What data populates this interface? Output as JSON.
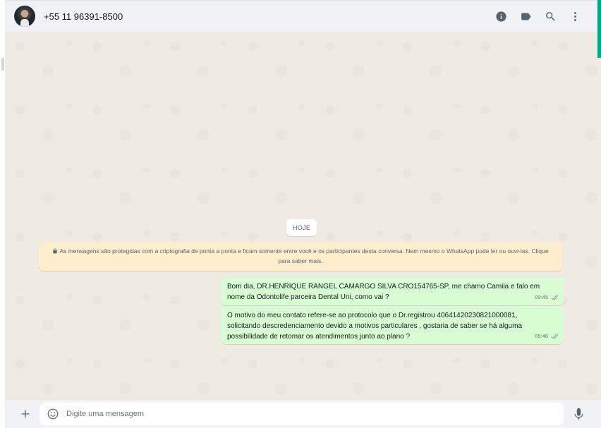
{
  "header": {
    "contact_name": "+55 11 96391-8500"
  },
  "chat": {
    "date_label": "HOJE",
    "encryption_notice": "As mensagens são protegidas com a criptografia de ponta a ponta e ficam somente entre você e os participantes desta conversa. Nem mesmo o WhatsApp pode ler ou ouvi-las. Clique para saber mais.",
    "messages": [
      {
        "text": "Bom dia, DR.HENRIQUE RANGEL CAMARGO SILVA CRO154765-SP, me chamo Camila e falo em\nnome da Odontolife parceira Dental Uni, como vai ?",
        "time": "09:45"
      },
      {
        "text": "O motivo do meu contato refere-se ao protocolo que o Dr.registrou 40641420230821000081,\nsolicitando descredenciamento devido a motivos particulares , gostaria de saber se há alguma\npossibilidade de retomar os atendimentos junto ao plano ?",
        "time": "09:46"
      }
    ]
  },
  "composer": {
    "placeholder": "Digite uma mensagem"
  },
  "icons": {
    "header": [
      "info-icon",
      "label-icon",
      "search-icon",
      "menu-dots-icon"
    ],
    "composer": [
      "plus-icon",
      "emoji-icon",
      "mic-icon"
    ],
    "message_status": "double-check-icon",
    "notice": "lock-icon"
  },
  "colors": {
    "accent": "#00a884",
    "header_bg": "#f0f2f5",
    "chat_bg": "#efeae2",
    "outgoing_bubble": "#d9fdd3",
    "notice_bg": "#ffeecd",
    "icon": "#54656f",
    "read_tick": "#8696a0"
  }
}
